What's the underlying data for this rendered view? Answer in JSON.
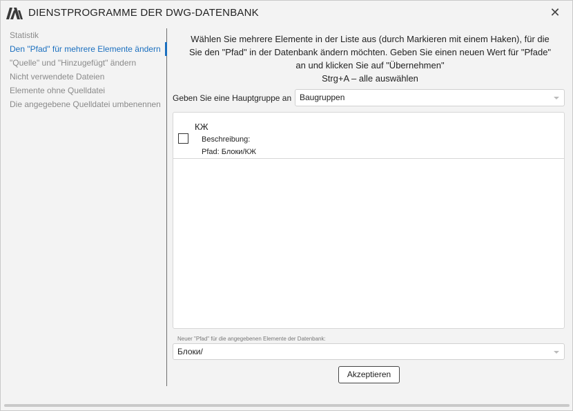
{
  "window": {
    "title": "DIENSTPROGRAMME DER DWG-DATENBANK",
    "close_glyph": "✕",
    "logo_icon": "app-logo-icon"
  },
  "sidebar": {
    "items": [
      {
        "label": "Statistik",
        "active": false
      },
      {
        "label": "Den \"Pfad\" für mehrere Elemente ändern",
        "active": true
      },
      {
        "label": "\"Quelle\" und \"Hinzugefügt\" ändern",
        "active": false
      },
      {
        "label": "Nicht verwendete Dateien",
        "active": false
      },
      {
        "label": "Elemente ohne Quelldatei",
        "active": false
      },
      {
        "label": "Die angegebene Quelldatei umbenennen",
        "active": false
      }
    ]
  },
  "main": {
    "instructions": [
      "Wählen Sie mehrere Elemente in der Liste aus (durch Markieren mit einem Haken), für die",
      "Sie den \"Pfad\" in der Datenbank ändern möchten. Geben Sie einen neuen Wert für \"Pfade\"",
      "an und klicken Sie auf \"Übernehmen\"",
      "Strg+A – alle auswählen"
    ],
    "group_label": "Geben Sie eine Hauptgruppe an",
    "group_value": "Baugruppen",
    "list": [
      {
        "name": "КЖ",
        "description": "Beschreibung:",
        "path": "Pfad: Блоки/КЖ",
        "checked": false
      }
    ],
    "new_path_label": "Neuer \"Pfad\" für die angegebenen Elemente der Datenbank:",
    "new_path_value": "Блоки/",
    "accept_label": "Akzeptieren"
  },
  "colors": {
    "accent": "#1a6fbf",
    "inactive_text": "#8a8a8a",
    "window_bg": "#f3f3f3"
  }
}
